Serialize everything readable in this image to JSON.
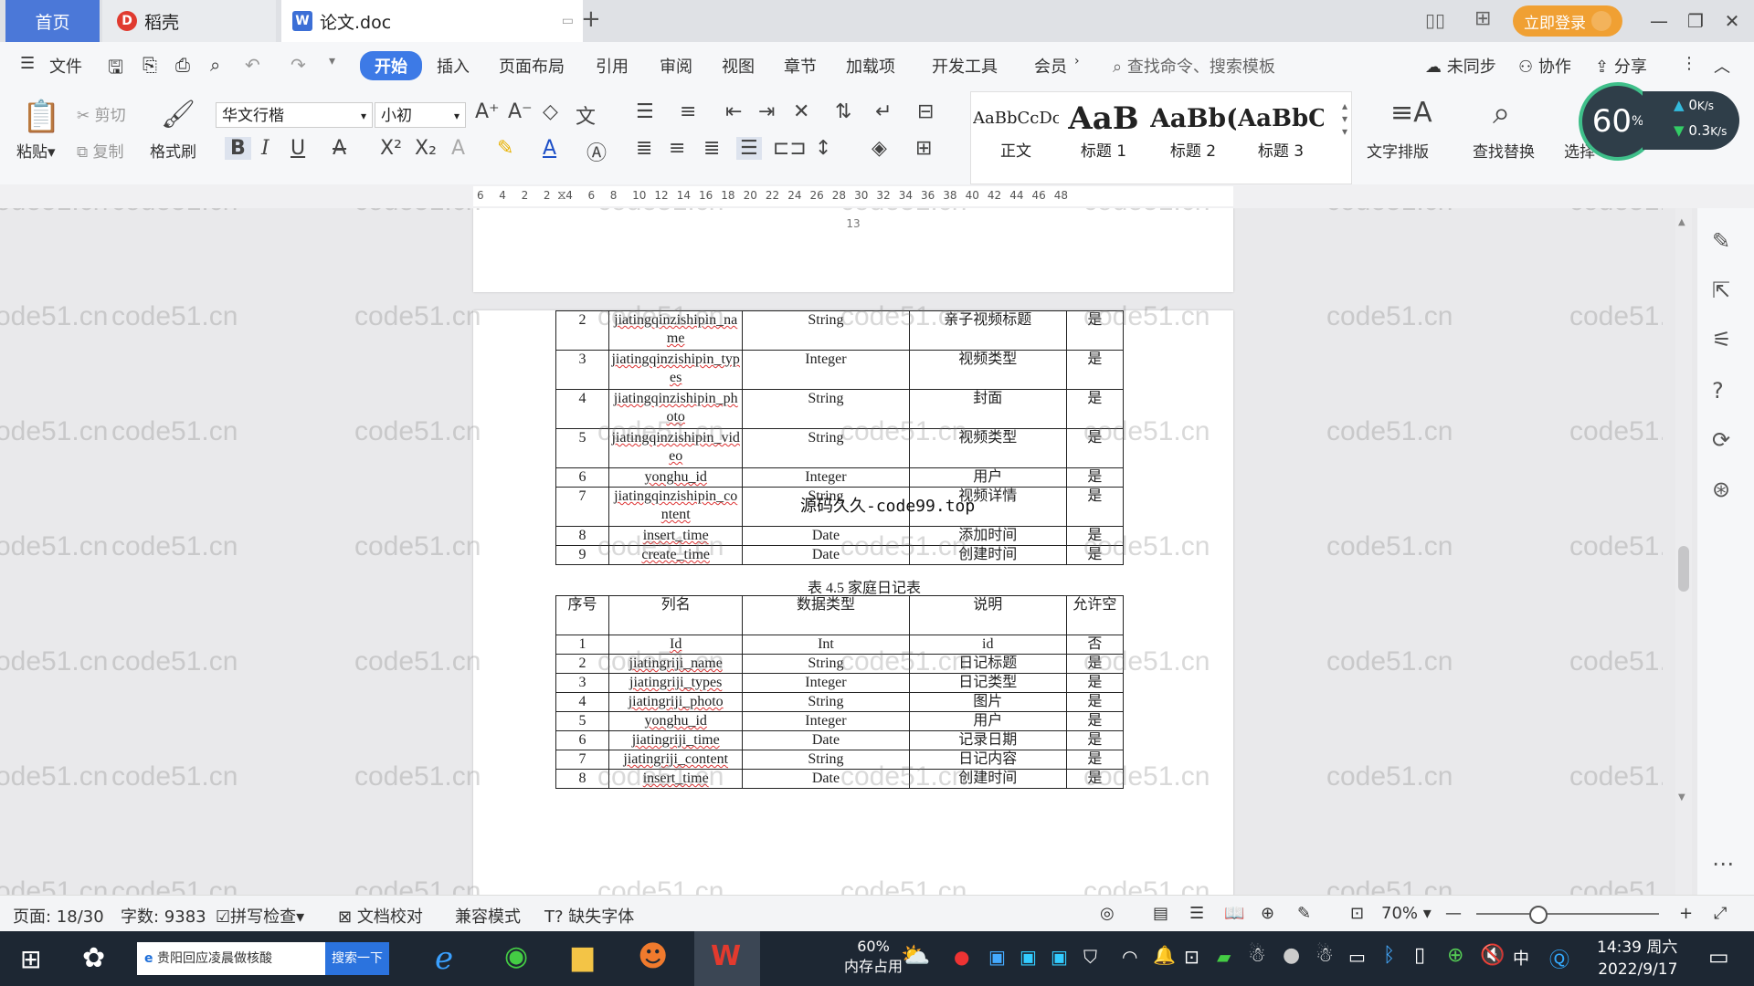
{
  "tabs": {
    "home": "首页",
    "daoke": "稻壳",
    "doc": "论文.doc",
    "new_tab": "+"
  },
  "login": "立即登录",
  "menu": {
    "file": "文件",
    "items": [
      "开始",
      "插入",
      "页面布局",
      "引用",
      "审阅",
      "视图",
      "章节",
      "加载项",
      "开发工具",
      "会员"
    ],
    "search": "查找命令、搜索模板",
    "unsynced": "未同步",
    "collab": "协作",
    "share": "分享"
  },
  "ribbon": {
    "paste": "粘贴",
    "cut": "剪切",
    "copy": "复制",
    "format_painter": "格式刷",
    "font": "华文行楷",
    "size": "小初",
    "styles": [
      {
        "sample": "AaBbCcDc",
        "name": "正文"
      },
      {
        "sample": "AaB",
        "name": "标题 1"
      },
      {
        "sample": "AaBb(",
        "name": "标题 2"
      },
      {
        "sample": "AaBbC",
        "name": "标题 3"
      }
    ],
    "text_layout": "文字排版",
    "find_replace": "查找替换",
    "select": "选择"
  },
  "speed": {
    "percent": "60",
    "percent_unit": "%",
    "up": "0",
    "up_unit": "K/s",
    "down": "0.3",
    "down_unit": "K/s"
  },
  "ruler": [
    "6",
    "4",
    "2",
    "2",
    "4",
    "6",
    "8",
    "10",
    "12",
    "14",
    "16",
    "18",
    "20",
    "22",
    "24",
    "26",
    "28",
    "30",
    "32",
    "34",
    "36",
    "38",
    "40",
    "42",
    "44",
    "46",
    "48"
  ],
  "document": {
    "page_number": "13",
    "overlay": "源码久久-code99.top",
    "table1_rows": [
      {
        "no": "2",
        "col": "jiatingqinzishipin_name",
        "type": "String",
        "desc": "亲子视频标题",
        "null": "是"
      },
      {
        "no": "3",
        "col": "jiatingqinzishipin_types",
        "type": "Integer",
        "desc": "视频类型",
        "null": "是"
      },
      {
        "no": "4",
        "col": "jiatingqinzishipin_photo",
        "type": "String",
        "desc": "封面",
        "null": "是"
      },
      {
        "no": "5",
        "col": "jiatingqinzishipin_video",
        "type": "String",
        "desc": "视频类型",
        "null": "是"
      },
      {
        "no": "6",
        "col": "yonghu_id",
        "type": "Integer",
        "desc": "用户",
        "null": "是"
      },
      {
        "no": "7",
        "col": "jiatingqinzishipin_content",
        "type": "String",
        "desc": "视频详情",
        "null": "是"
      },
      {
        "no": "8",
        "col": "insert_time",
        "type": "Date",
        "desc": "添加时间",
        "null": "是"
      },
      {
        "no": "9",
        "col": "create_time",
        "type": "Date",
        "desc": "创建时间",
        "null": "是"
      }
    ],
    "caption": "表 4.5 家庭日记表",
    "table2_header": {
      "no": "序号",
      "col": "列名",
      "type": "数据类型",
      "desc": "说明",
      "null": "允许空"
    },
    "table2_rows": [
      {
        "no": "1",
        "col": "Id",
        "type": "Int",
        "desc": "id",
        "null": "否"
      },
      {
        "no": "2",
        "col": "jiatingriji_name",
        "type": "String",
        "desc": "日记标题",
        "null": "是"
      },
      {
        "no": "3",
        "col": "jiatingriji_types",
        "type": "Integer",
        "desc": "日记类型",
        "null": "是"
      },
      {
        "no": "4",
        "col": "jiatingriji_photo",
        "type": "String",
        "desc": "图片",
        "null": "是"
      },
      {
        "no": "5",
        "col": "yonghu_id",
        "type": "Integer",
        "desc": "用户",
        "null": "是"
      },
      {
        "no": "6",
        "col": "jiatingriji_time",
        "type": "Date",
        "desc": "记录日期",
        "null": "是"
      },
      {
        "no": "7",
        "col": "jiatingriji_content",
        "type": "String",
        "desc": "日记内容",
        "null": "是"
      },
      {
        "no": "8",
        "col": "insert_time",
        "type": "Date",
        "desc": "创建时间",
        "null": "是"
      }
    ]
  },
  "watermark": "code51.cn",
  "status": {
    "page": "页面: 18/30",
    "words": "字数: 9383",
    "spell": "拼写检查",
    "proof": "文档校对",
    "compat": "兼容模式",
    "missing_font": "缺失字体",
    "zoom": "70%"
  },
  "taskbar": {
    "search_text": "贵阳回应凌晨做核酸",
    "search_btn": "搜索一下",
    "mem_percent": "60%",
    "mem_label": "内存占用",
    "ime": "中",
    "time": "14:39 周六",
    "date": "2022/9/17"
  }
}
